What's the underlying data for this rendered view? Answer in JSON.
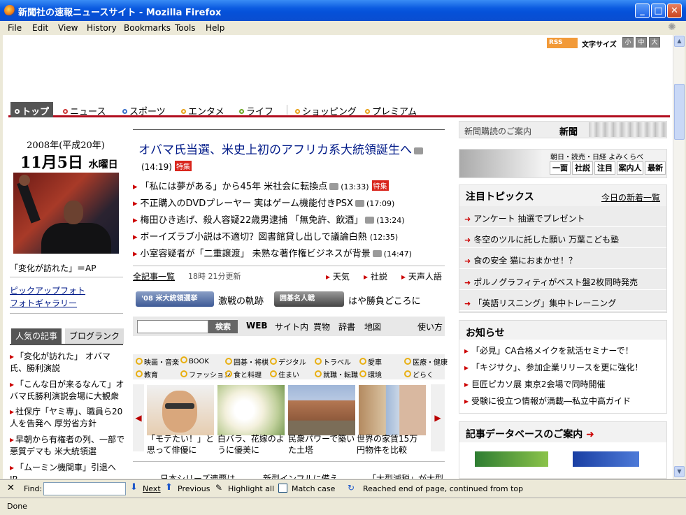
{
  "window": {
    "title": "新聞社の速報ニュースサイト - Mozilla Firefox",
    "min": "_",
    "max": "□",
    "close": "✕"
  },
  "menu": [
    "File",
    "Edit",
    "View",
    "History",
    "Bookmarks",
    "Tools",
    "Help"
  ],
  "util": {
    "rss": "RSS",
    "font_size": "文字サイズ",
    "sizes": [
      "小",
      "中",
      "大"
    ]
  },
  "nav": [
    {
      "label": "トップ",
      "active": true
    },
    {
      "label": "ニュース"
    },
    {
      "label": "スポーツ"
    },
    {
      "label": "エンタメ"
    },
    {
      "label": "ライフ"
    },
    {
      "label": "ショッピング"
    },
    {
      "label": "プレミアム"
    }
  ],
  "date": {
    "line1": "2008年(平成20年)",
    "md": "11月5日",
    "wd": "水曜日"
  },
  "photo_caption": "「変化が訪れた」＝AP",
  "left_links": [
    "ピックアップフォト",
    "フォトギャラリー"
  ],
  "left_tabs": [
    "人気の記事",
    "ブログランク"
  ],
  "left_news": [
    "「変化が訪れた」 オバマ氏、勝利演説",
    "「こんな日が来るなんて」オバマ氏勝利演説会場に大観衆",
    "社保庁「ヤミ専」、職員ら20人を告発へ 厚労省方針",
    "早朝から有権者の列、一部で悪質デマも 米大統領選",
    "「ムーミン機関車」引退へ JR"
  ],
  "headline": {
    "title": "オバマ氏当選、米史上初のアフリカ系大統領誕生へ",
    "time": "(14:19)",
    "badge": "特集"
  },
  "news": [
    {
      "text": "「私には夢がある」から45年 米社会に転換点",
      "time": "(13:33)",
      "badge": "特集"
    },
    {
      "text": "不正購入のDVDプレーヤー 実はゲーム機能付きPSX",
      "time": "(17:09)"
    },
    {
      "text": "梅田ひき逃げ、殺人容疑22歳男逮捕 「無免許、飲酒」",
      "time": "(13:24)"
    },
    {
      "text": "ボーイズラブ小説は不適切？図書館貸し出しで議論白熱",
      "time": "(12:35)"
    },
    {
      "text": "小室容疑者が「二重譲渡」 未熟な著作権ビジネスが背景",
      "time": "(14:47)"
    }
  ],
  "links_row": {
    "all": "全記事一覧",
    "updated": "18時 21分更新",
    "tenki": "天気",
    "shasetsu": "社説",
    "tensei": "天声人語"
  },
  "banners": [
    {
      "label": "'08 米大統領選挙",
      "text": "激戦の軌跡"
    },
    {
      "label": "囲碁名人戦",
      "text": "はや勝負どころに"
    }
  ],
  "search": {
    "button": "検索",
    "options": [
      "WEB",
      "サイト内",
      "買物",
      "辞書",
      "地図"
    ],
    "help": "使い方",
    "placeholder": ""
  },
  "categories": [
    "映画・音楽",
    "BOOK",
    "囲碁・将棋",
    "デジタル",
    "トラベル",
    "愛車",
    "医療・健康",
    "教育",
    "ファッション",
    "食と料理",
    "住まい",
    "就職・転職",
    "環境",
    "どらく"
  ],
  "photos": [
    {
      "caption": "「モテたい！」と思って俳優に"
    },
    {
      "caption": "白バラ、花嫁のように優美に"
    },
    {
      "caption": "民衆パワーで築いた土塔"
    },
    {
      "caption": "世界の家賃15万円物件を比較"
    }
  ],
  "bottom_row": [
    "日本シリーズ連覇は",
    "新型インフルに備え",
    "「大型減税」が大型"
  ],
  "right": {
    "subscribe": "新聞購読のご案内",
    "shinbun": "新聞",
    "compare": "朝日・読売・日経 よみくらべ",
    "compare_btns": [
      "一面",
      "社説",
      "注目",
      "案内人",
      "最新"
    ],
    "topics_title": "注目トピックス",
    "topics_link": "今日の新着一覧",
    "topics": [
      "アンケート 抽選でプレゼント",
      "冬空のツルに託した願い 万葉こども塾",
      "食の安全 猫におまかせ！？",
      "ポルノグラフィティがベスト盤2枚同時発売",
      "「英語リスニング」集中トレーニング"
    ],
    "notice_title": "お知らせ",
    "notices": [
      "「必見」CA合格メイクを就活セミナーで！",
      "「キジサク」、参加企業リリースを更に強化！",
      "巨匠ピカソ展 東京2会場で同時開催",
      "受験に役立つ情報が満載―私立中高ガイド"
    ],
    "db_title": "記事データベースのご案内"
  },
  "findbar": {
    "close": "✕",
    "label": "Find:",
    "next": "Next",
    "previous": "Previous",
    "highlight": "Highlight all",
    "match_case": "Match case",
    "status": "Reached end of page, continued from top"
  },
  "status": "Done",
  "colors": {
    "accent": "#b10e1e",
    "link": "#001a88",
    "badge": "#d9251c"
  }
}
